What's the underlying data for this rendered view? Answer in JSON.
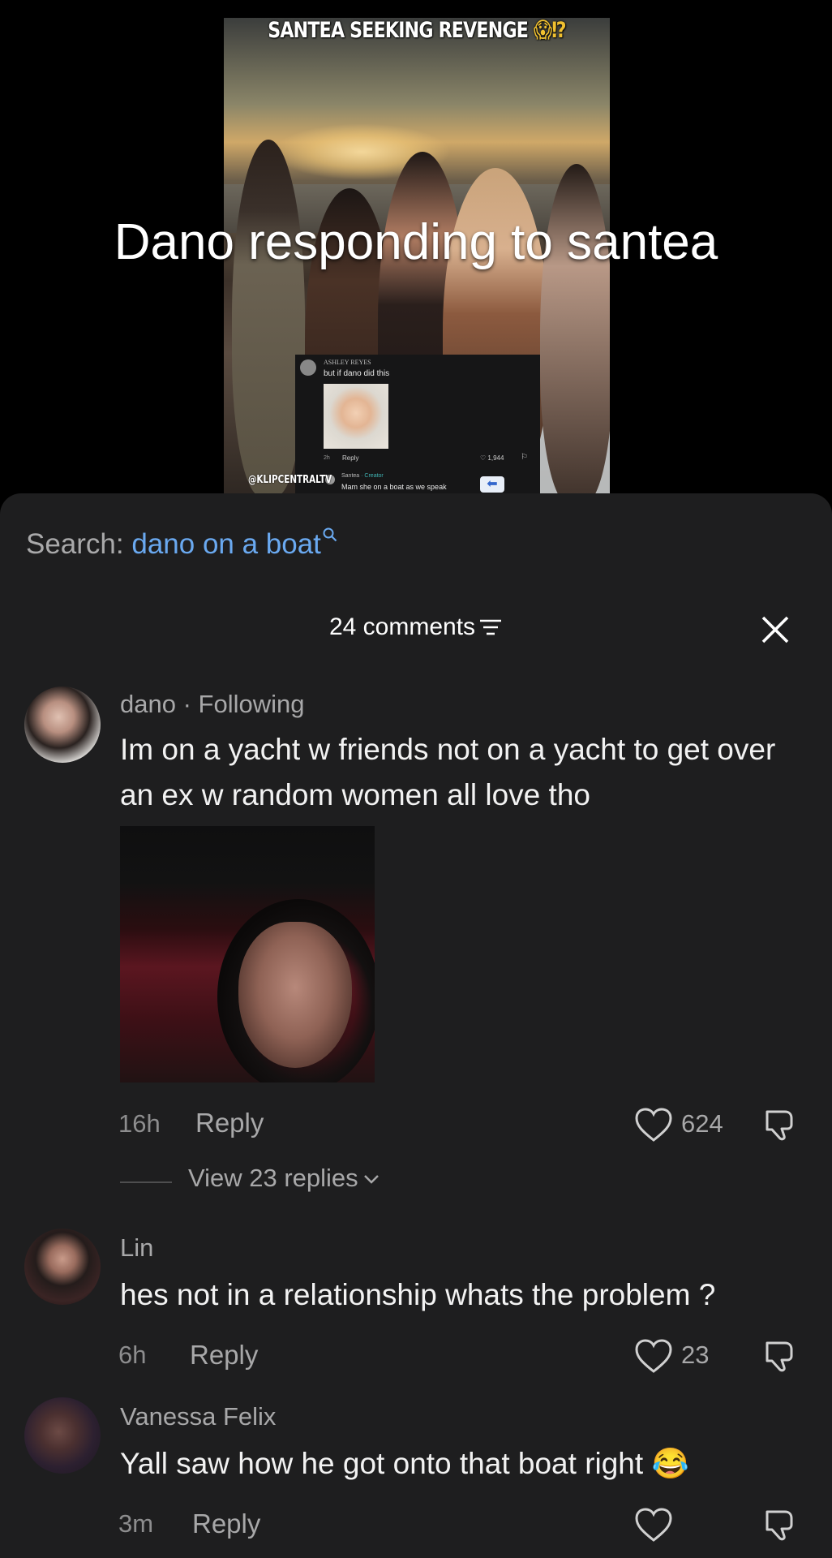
{
  "video": {
    "top_caption": "SANTEA SEEKING REVENGE",
    "top_caption_emoji": "😱⁉",
    "overlay_title": "Dano responding to santea",
    "watermark": "@KLIPCENTRALTV",
    "embedded_comment": {
      "name": "ASHLEY REYES",
      "text": "but if dano did this",
      "time": "2h",
      "reply": "Reply",
      "likes": "1,944",
      "creator_name": "Santea",
      "creator_tag": "· Creator",
      "creator_text": "Mam she on a boat as we speak"
    }
  },
  "sheet": {
    "search_label": "Search:",
    "search_term": "dano on a boat",
    "comments_count": "24 comments"
  },
  "comments": [
    {
      "name": "dano · Following",
      "text": "Im on a yacht w friends not on a yacht to get over an ex w random women all love tho",
      "time": "16h",
      "reply": "Reply",
      "likes": "624",
      "view_replies": "View 23 replies"
    },
    {
      "name": "Lin",
      "text": "hes not in a relationship whats the problem ?",
      "time": "6h",
      "reply": "Reply",
      "likes": "23"
    },
    {
      "name": "Vanessa Felix",
      "text": "Yall saw how he got onto that boat right 😂",
      "time": "3m",
      "reply": "Reply",
      "likes": ""
    }
  ],
  "colors": {
    "sheet_bg": "#1e1e1f",
    "search_term": "#6aa9f0",
    "secondary_text": "#a8a8a9"
  }
}
